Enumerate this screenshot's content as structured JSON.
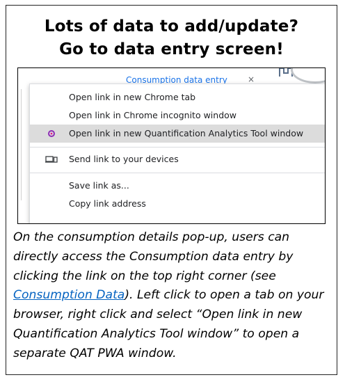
{
  "callout": {
    "heading_line1": "Lots of data to add/update?",
    "heading_line2": "Go to data entry screen!"
  },
  "screenshot": {
    "background_tab_label": "Consumption data entry",
    "background_close_glyph": "×",
    "context_menu": {
      "items": [
        {
          "label": "Open link in new Chrome tab",
          "icon": null,
          "highlighted": false
        },
        {
          "label": "Open link in Chrome incognito window",
          "icon": null,
          "highlighted": false
        },
        {
          "label": "Open link in new Quantification Analytics Tool window",
          "icon": "qat-app-icon",
          "highlighted": true
        },
        {
          "label": "Send link to your devices",
          "icon": "devices-icon",
          "highlighted": false
        },
        {
          "label": "Save link as...",
          "icon": null,
          "highlighted": false
        },
        {
          "label": "Copy link address",
          "icon": null,
          "highlighted": false
        }
      ],
      "highlight_color": "#dcdcdc"
    }
  },
  "caption": {
    "part1": "On the consumption details pop-up, users can directly access the Consumption data entry by clicking the link on the top right corner (see ",
    "link_text": "Consumption Data",
    "part2": "). Left click to open a tab on your browser, right click and select “Open link in new Quantification Analytics Tool window” to open a separate QAT PWA window."
  },
  "colors": {
    "link": "#0563c1",
    "tab_link": "#1a73e8",
    "qat_icon": "#8e2eb5"
  }
}
